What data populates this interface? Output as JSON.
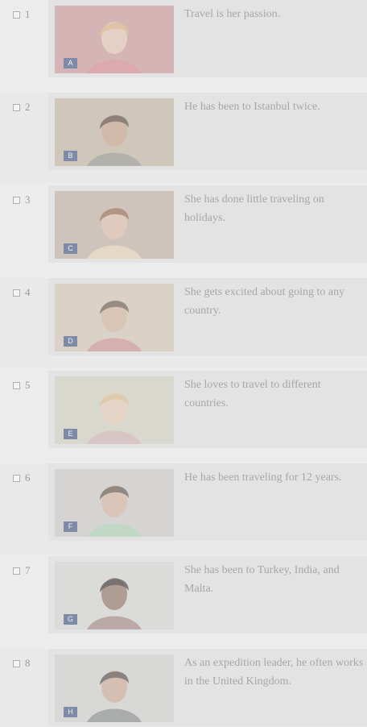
{
  "items": [
    {
      "number": "1",
      "label": "A",
      "text": "Travel is her passion.",
      "bg": "#c66c6c",
      "skin": "#e6c9b7",
      "hair": "#d8b07a",
      "shirt": "#d6848d"
    },
    {
      "number": "2",
      "label": "B",
      "text": "He has been to Istanbul twice.",
      "bg": "#b7a07b",
      "skin": "#c79f88",
      "hair": "#4b3b34",
      "shirt": "#8f8e89"
    },
    {
      "number": "3",
      "label": "C",
      "text": "She has done little traveling on holidays.",
      "bg": "#b49982",
      "skin": "#dfbda6",
      "hair": "#8a5a42",
      "shirt": "#e7d7b8"
    },
    {
      "number": "4",
      "label": "D",
      "text": "She gets excited about going to any country.",
      "bg": "#d9c1a2",
      "skin": "#cfb097",
      "hair": "#5d4a3e",
      "shirt": "#c88a8e"
    },
    {
      "number": "5",
      "label": "E",
      "text": "She loves to travel to different countries.",
      "bg": "#d6d0b5",
      "skin": "#e7c9b5",
      "hair": "#d7ba87",
      "shirt": "#cfaeb2"
    },
    {
      "number": "6",
      "label": "F",
      "text": "He has been traveling for 12 years.",
      "bg": "#c9c7bf",
      "skin": "#d4b09a",
      "hair": "#4f443d",
      "shirt": "#a7d0b3"
    },
    {
      "number": "7",
      "label": "G",
      "text": "She has been to Turkey, India, and Malta.",
      "bg": "#d9d9d7",
      "skin": "#8a6a5c",
      "hair": "#2f2727",
      "shirt": "#9a7a78"
    },
    {
      "number": "8",
      "label": "H",
      "text": "As an expedition leader, he often works in the United Kingdom.",
      "bg": "#d0d4cc",
      "skin": "#c9a58f",
      "hair": "#433936",
      "shirt": "#7c7f7e"
    }
  ]
}
